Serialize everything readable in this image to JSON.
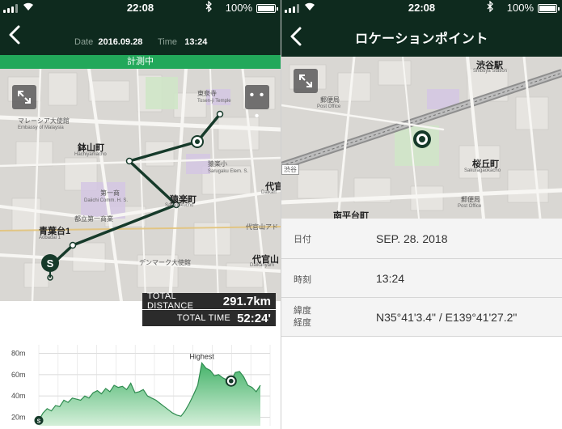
{
  "status_bar": {
    "time": "22:08",
    "battery": "100%"
  },
  "left": {
    "date_label": "Date",
    "date_value": "2016.09.28",
    "time_label": "Time",
    "time_value": "13:24",
    "measuring_banner": "計測中",
    "map_labels": {
      "malaysia_embassy": "マレーシア大使館",
      "malaysia_embassy_en": "Embassy of Malaysia",
      "hachiyamacho": "鉢山町",
      "hachiyamacho_en": "Hachiyamacho",
      "daiichi_shokyo": "第一商",
      "daiichi_shokyo_en": "Daiichi Comm. H. S.",
      "toritsu_daiichi": "都立第一商業",
      "sarugakucho": "猿楽町",
      "sarugakucho_en": "Sarugakucho",
      "sarugaku_sho": "猿楽小",
      "sarugaku_sho_en": "Sarugaku Elem. S.",
      "tosenji": "東泉寺",
      "tosenji_en": "Tosen-ji Temple",
      "aobadai": "青葉台1",
      "aobadai_en": "Aobadai 1",
      "daikanyama": "代官",
      "daikanyama_en": "Daikan",
      "daikanyama_address": "代官山アド",
      "daikanyama_station": "代官山",
      "daikanyama_station_en": "Daikanyam",
      "denmark_embassy": "デンマーク大使館"
    },
    "more_label": "• • •",
    "stats": {
      "distance_label": "TOTAL DISTANCE",
      "distance_value": "291.7km",
      "time_label": "TOTAL TIME",
      "time_value": "52:24'"
    },
    "start_marker": "S"
  },
  "right": {
    "title": "ロケーションポイント",
    "map_labels": {
      "shibuya_station": "渋谷駅",
      "shibuya_station_en": "Shibuya Station",
      "post_office": "郵便局",
      "post_office_en": "Post Office",
      "sakuragaokacho": "桜丘町",
      "sakuragaokacho_en": "Sakuragaokacho",
      "post_office2": "郵便局",
      "post_office2_en": "Post Office",
      "nanpeidaimachi": "南平台町",
      "rail_badge": "渋谷"
    },
    "info": {
      "date_key": "日付",
      "date_value": "SEP. 28. 2018",
      "time_key": "時刻",
      "time_value": "13:24",
      "latlng_key_1": "緯度",
      "latlng_key_2": "経度",
      "latlng_value": "N35°41'3.4\" / E139°41'27.2\""
    }
  },
  "chart_data": {
    "type": "area",
    "title": "",
    "xlabel": "",
    "ylabel": "",
    "y_ticks": [
      "20m",
      "40m",
      "60m",
      "80m"
    ],
    "ylim": [
      12,
      88
    ],
    "annotation": "Highest",
    "start_marker": "S",
    "values": [
      17,
      24,
      28,
      26,
      31,
      30,
      36,
      34,
      38,
      37,
      36,
      40,
      38,
      43,
      45,
      42,
      47,
      44,
      50,
      48,
      49,
      46,
      52,
      43,
      44,
      46,
      40,
      38,
      36,
      33,
      30,
      27,
      24,
      22,
      21,
      26,
      33,
      41,
      50,
      71,
      66,
      64,
      59,
      60,
      57,
      55,
      54,
      62,
      63,
      58,
      50,
      48,
      44,
      50
    ],
    "highest_index": 39,
    "marker_index": 46,
    "colors": {
      "fill_top": "#45b36a",
      "fill_bottom": "#d4efd9",
      "line": "#2e8b4f",
      "marker": "#163a2a"
    }
  },
  "colors": {
    "header": "#0e2a1e",
    "banner": "#22a85a",
    "route": "#163a2a"
  }
}
